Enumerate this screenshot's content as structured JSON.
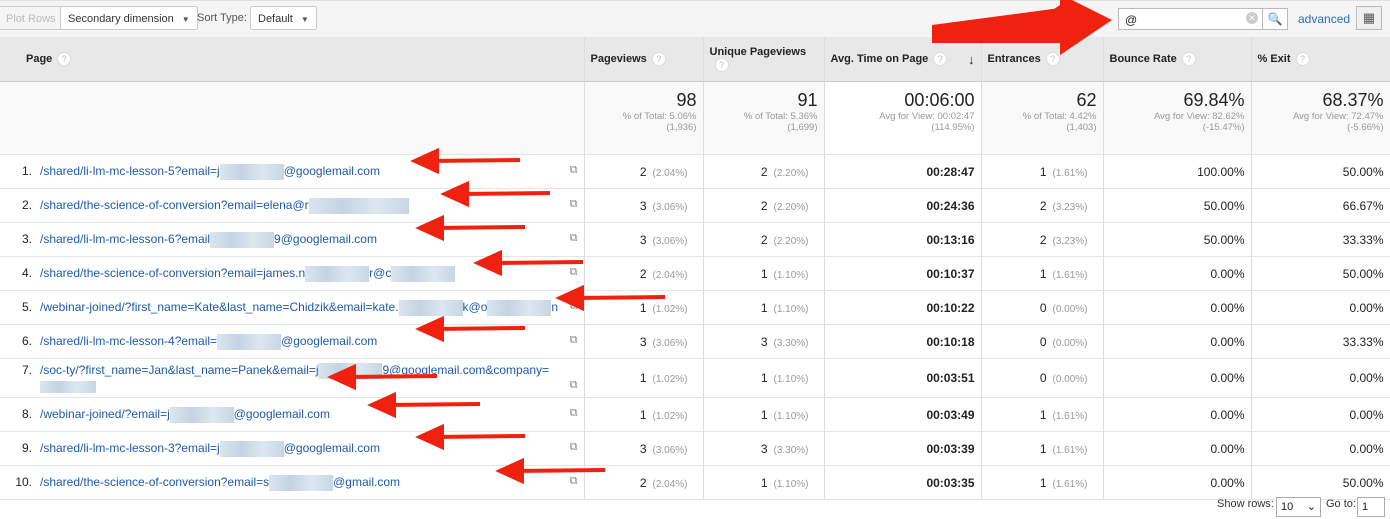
{
  "toolbar": {
    "plot_rows": "Plot Rows",
    "secondary_dimension": "Secondary dimension",
    "sort_type_label": "Sort Type:",
    "sort_type_value": "Default",
    "search_value": "@",
    "advanced": "advanced"
  },
  "columns": [
    "Page",
    "Pageviews",
    "Unique Pageviews",
    "Avg. Time on Page",
    "Entrances",
    "Bounce Rate",
    "% Exit"
  ],
  "totals": [
    {
      "value": "98",
      "line1": "% of Total: 5.06%",
      "line2": "(1,936)"
    },
    {
      "value": "91",
      "line1": "% of Total: 5.36%",
      "line2": "(1,699)"
    },
    {
      "value": "00:06:00",
      "line1": "Avg for View: 00:02:47",
      "line2": "(114.95%)"
    },
    {
      "value": "62",
      "line1": "% of Total: 4.42%",
      "line2": "(1,403)"
    },
    {
      "value": "69.84%",
      "line1": "Avg for View: 82.62%",
      "line2": "(-15.47%)"
    },
    {
      "value": "68.37%",
      "line1": "Avg for View: 72.47%",
      "line2": "(-5.66%)"
    }
  ],
  "rows": [
    {
      "n": "1.",
      "pre": "/shared/li-lm-mc-lesson-5?email=j",
      "post": "@googlemail.com",
      "post2": "",
      "pv": "2",
      "pvp": "(2.04%)",
      "upv": "2",
      "upvp": "(2.20%)",
      "time": "00:28:47",
      "ent": "1",
      "entp": "(1.61%)",
      "br": "100.00%",
      "ex": "50.00%"
    },
    {
      "n": "2.",
      "pre": "/shared/the-science-of-conversion?email=elena@r",
      "post": "",
      "post2": "",
      "pv": "3",
      "pvp": "(3.06%)",
      "upv": "2",
      "upvp": "(2.20%)",
      "time": "00:24:36",
      "ent": "2",
      "entp": "(3.23%)",
      "br": "50.00%",
      "ex": "66.67%"
    },
    {
      "n": "3.",
      "pre": "/shared/li-lm-mc-lesson-6?email",
      "post": "9@googlemail.com",
      "post2": "",
      "pv": "3",
      "pvp": "(3.06%)",
      "upv": "2",
      "upvp": "(2.20%)",
      "time": "00:13:16",
      "ent": "2",
      "entp": "(3.23%)",
      "br": "50.00%",
      "ex": "33.33%"
    },
    {
      "n": "4.",
      "pre": "/shared/the-science-of-conversion?email=james.n",
      "post": "r@c",
      "post2": "",
      "pv": "2",
      "pvp": "(2.04%)",
      "upv": "1",
      "upvp": "(1.10%)",
      "time": "00:10:37",
      "ent": "1",
      "entp": "(1.61%)",
      "br": "0.00%",
      "ex": "50.00%"
    },
    {
      "n": "5.",
      "pre": "/webinar-joined/?first_name=Kate&last_name=Chidzik&email=kate.",
      "post": "k@o",
      "post2": "n",
      "pv": "1",
      "pvp": "(1.02%)",
      "upv": "1",
      "upvp": "(1.10%)",
      "time": "00:10:22",
      "ent": "0",
      "entp": "(0.00%)",
      "br": "0.00%",
      "ex": "0.00%"
    },
    {
      "n": "6.",
      "pre": "/shared/li-lm-mc-lesson-4?email=",
      "post": "@googlemail.com",
      "post2": "",
      "pv": "3",
      "pvp": "(3.06%)",
      "upv": "3",
      "upvp": "(3.30%)",
      "time": "00:10:18",
      "ent": "0",
      "entp": "(0.00%)",
      "br": "0.00%",
      "ex": "33.33%"
    },
    {
      "n": "7.",
      "pre": "/soc-ty/?first_name=Jan&last_name=Panek&email=j",
      "post": "9@googlemail.com&company=",
      "post2": "",
      "pv": "1",
      "pvp": "(1.02%)",
      "upv": "1",
      "upvp": "(1.10%)",
      "time": "00:03:51",
      "ent": "0",
      "entp": "(0.00%)",
      "br": "0.00%",
      "ex": "0.00%"
    },
    {
      "n": "8.",
      "pre": "/webinar-joined/?email=j",
      "post": "@googlemail.com",
      "post2": "",
      "pv": "1",
      "pvp": "(1.02%)",
      "upv": "1",
      "upvp": "(1.10%)",
      "time": "00:03:49",
      "ent": "1",
      "entp": "(1.61%)",
      "br": "0.00%",
      "ex": "0.00%"
    },
    {
      "n": "9.",
      "pre": "/shared/li-lm-mc-lesson-3?email=j",
      "post": "@googlemail.com",
      "post2": "",
      "pv": "3",
      "pvp": "(3.06%)",
      "upv": "3",
      "upvp": "(3.30%)",
      "time": "00:03:39",
      "ent": "1",
      "entp": "(1.61%)",
      "br": "0.00%",
      "ex": "0.00%"
    },
    {
      "n": "10.",
      "pre": "/shared/the-science-of-conversion?email=s",
      "post": "@gmail.com",
      "post2": "",
      "pv": "2",
      "pvp": "(2.04%)",
      "upv": "1",
      "upvp": "(1.10%)",
      "time": "00:03:35",
      "ent": "1",
      "entp": "(1.61%)",
      "br": "0.00%",
      "ex": "50.00%"
    }
  ],
  "footer": {
    "show_rows_label": "Show rows:",
    "show_rows_value": "10",
    "goto_label": "Go to:",
    "goto_value": "1"
  },
  "colors": {
    "link": "#1e5aa8",
    "annotation_arrow": "#f0210e"
  }
}
